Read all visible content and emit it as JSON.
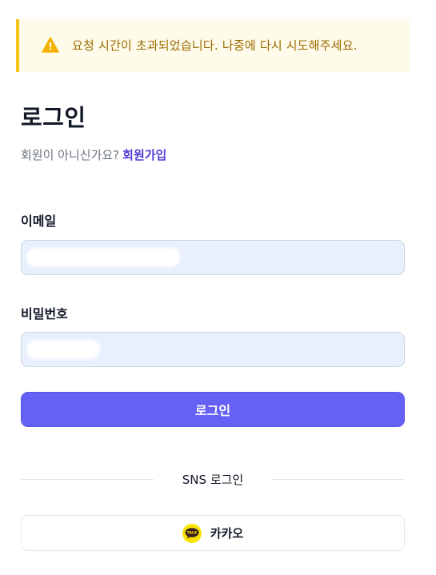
{
  "alert": {
    "icon": "warning-icon",
    "message": "요청 시간이 초과되었습니다. 나중에 다시 시도해주세요.",
    "accent_color": "#f5c518",
    "background_color": "#fffbea",
    "text_color": "#9a6a00"
  },
  "form": {
    "title": "로그인",
    "signup_prompt": "회원이 아니신가요?",
    "signup_link": "회원가입",
    "email_label": "이메일",
    "email_value": "",
    "password_label": "비밀번호",
    "password_value": "",
    "submit_label": "로그인",
    "submit_color": "#6561f5"
  },
  "sns": {
    "divider_label": "SNS 로그인",
    "kakao_label": "카카오",
    "kakao_icon": "kakao-talk-icon",
    "kakao_icon_text": "TALK",
    "kakao_color": "#fae100"
  }
}
